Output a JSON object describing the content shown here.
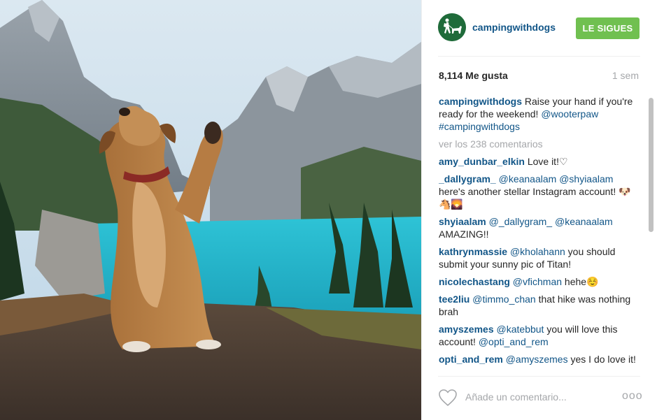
{
  "post": {
    "username": "campingwithdogs",
    "follow_label": "LE SIGUES",
    "likes": "8,114 Me gusta",
    "time": "1 sem",
    "caption": {
      "user": "campingwithdogs",
      "text": " Raise your hand if you're ready for the weekend! ",
      "mention1": "@wooterpaw",
      "mention2": " #campingwithdogs"
    },
    "view_all": "ver los 238 comentarios",
    "comments": [
      {
        "user": "amy_dunbar_elkin",
        "parts": [
          {
            "t": " Love it!♡",
            "m": false
          }
        ]
      },
      {
        "user": "_dallygram_",
        "parts": [
          {
            "t": " @keanaalam",
            "m": true
          },
          {
            "t": " ",
            "m": false
          },
          {
            "t": "@shyiaalam",
            "m": true
          },
          {
            "t": " here's another stellar Instagram account! 🐶🐴🌄",
            "m": false
          }
        ]
      },
      {
        "user": "shyiaalam",
        "parts": [
          {
            "t": " @_dallygram_",
            "m": true
          },
          {
            "t": " ",
            "m": false
          },
          {
            "t": "@keanaalam",
            "m": true
          },
          {
            "t": " AMAZING!!",
            "m": false
          }
        ]
      },
      {
        "user": "kathrynmassie",
        "parts": [
          {
            "t": " @kholahann",
            "m": true
          },
          {
            "t": " you should submit your sunny pic of Titan!",
            "m": false
          }
        ]
      },
      {
        "user": "nicolechastang",
        "parts": [
          {
            "t": " @vfichman",
            "m": true
          },
          {
            "t": " hehe☺️",
            "m": false
          }
        ]
      },
      {
        "user": "tee2liu",
        "parts": [
          {
            "t": " @timmo_chan",
            "m": true
          },
          {
            "t": " that hike was nothing brah",
            "m": false
          }
        ]
      },
      {
        "user": "amyszemes",
        "parts": [
          {
            "t": " @katebbut",
            "m": true
          },
          {
            "t": " you will love this account! ",
            "m": false
          },
          {
            "t": "@opti_and_rem",
            "m": true
          }
        ]
      },
      {
        "user": "opti_and_rem",
        "parts": [
          {
            "t": " @amyszemes",
            "m": true
          },
          {
            "t": " yes I do love it!",
            "m": false
          }
        ]
      }
    ],
    "comment_placeholder": "Añade un comentario...",
    "more_label": "ooo"
  },
  "icons": {
    "avatar": "hiker-with-dog-logo",
    "like": "heart-outline-icon",
    "more": "more-options-icon"
  },
  "colors": {
    "link": "#125688",
    "follow_button": "#70c050",
    "muted": "#a5a7aa",
    "avatar_bg": "#1f6b3a"
  }
}
